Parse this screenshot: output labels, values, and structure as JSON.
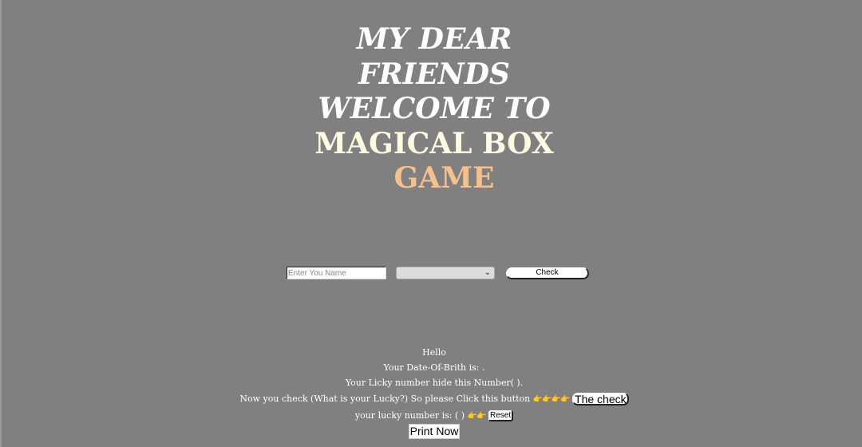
{
  "title": {
    "line1": "MY DEAR",
    "line2": "FRIENDS",
    "line3": "WELCOME TO",
    "line4": "MAGICAL BOX",
    "line5": "GAME"
  },
  "form": {
    "name_placeholder": "Enter You Name",
    "name_value": "",
    "select_value": "",
    "check_label": "Check"
  },
  "result": {
    "hello": "Hello",
    "dob_line": "Your Date-Of-Brith is:   .",
    "hidden_line": "Your Licky number hide this Number(  ).",
    "check_prompt": "Now you check (What is your Lucky?) So please Click this button",
    "pointer_emoji_4": "👉👉👉👉",
    "check_button": "The check",
    "lucky_line": "your lucky number is: (  )",
    "pointer_emoji_2": "👉👉",
    "reset_button": "Reset",
    "print_button": "Print Now"
  },
  "colors": {
    "background": "#808080",
    "title_white": "#ffffff",
    "title_cream": "#fffbe3",
    "title_peach": "#f6c08b"
  }
}
